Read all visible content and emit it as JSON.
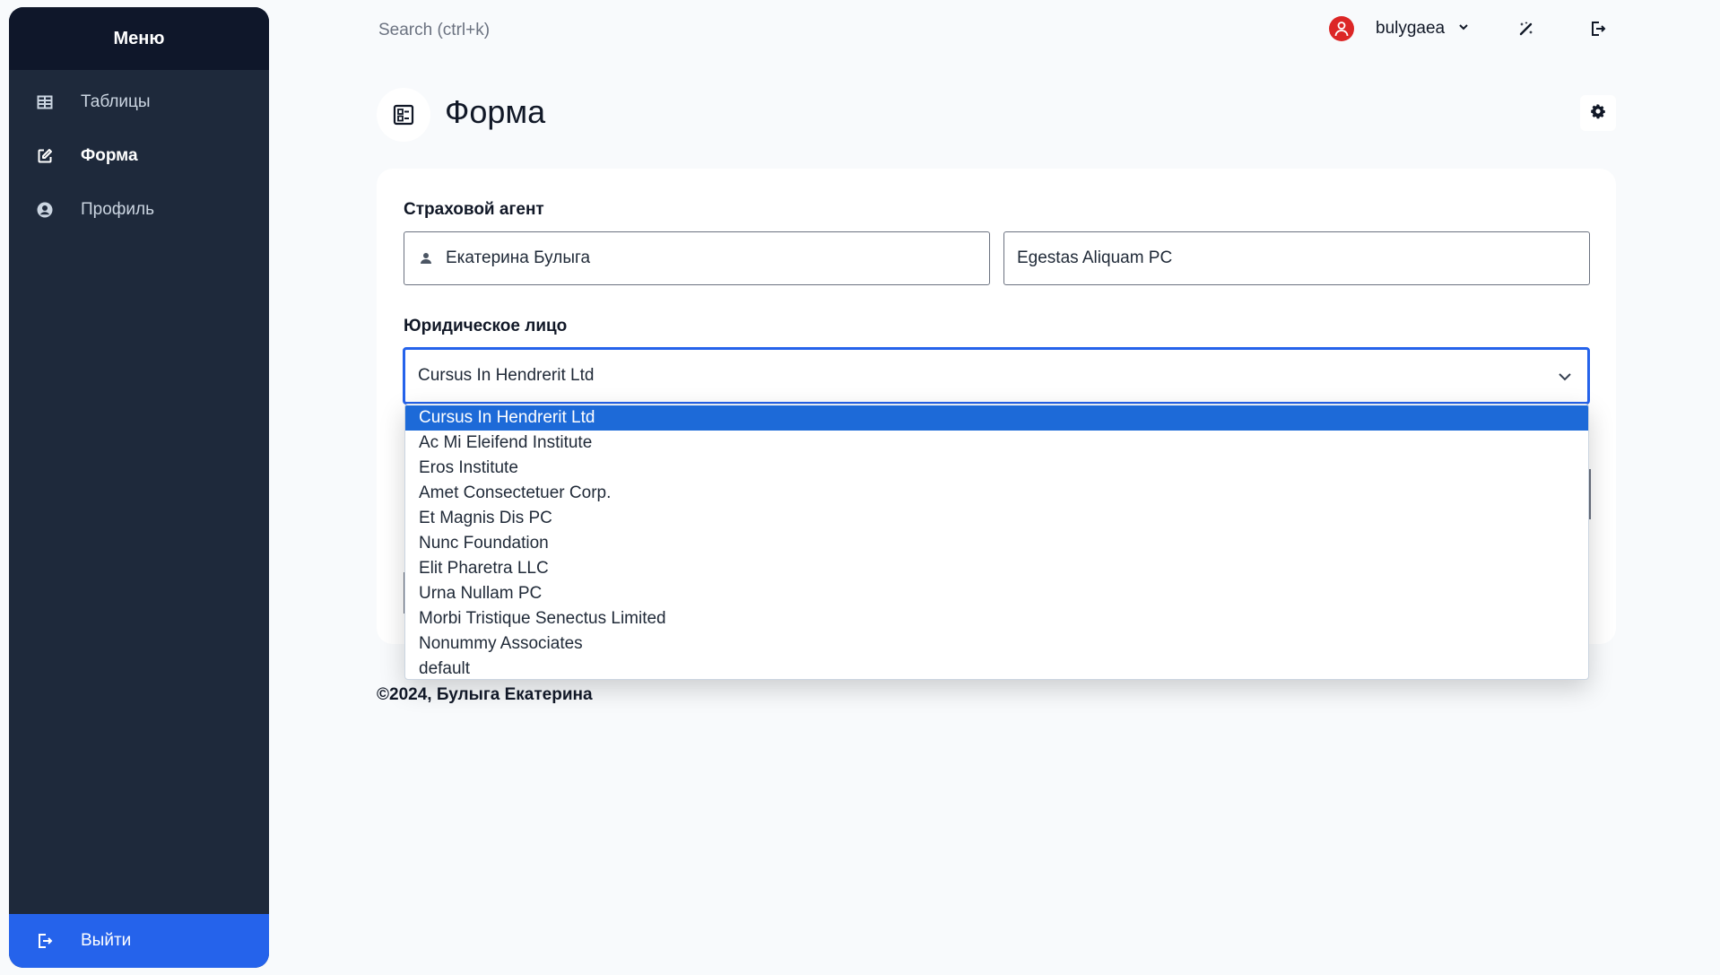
{
  "sidebar": {
    "title": "Меню",
    "items": [
      {
        "label": "Таблицы",
        "icon": "table-icon"
      },
      {
        "label": "Форма",
        "icon": "edit-icon"
      },
      {
        "label": "Профиль",
        "icon": "user-circle-icon"
      }
    ],
    "logout_label": "Выйти",
    "colors": {
      "bg": "#1e293b",
      "header": "#0f172a",
      "logout": "#2563eb"
    }
  },
  "topbar": {
    "search_placeholder": "Search (ctrl+k)",
    "username": "bulygaea"
  },
  "page": {
    "title": "Форма"
  },
  "form": {
    "agent_label": "Страховой агент",
    "agent_name": "Екатерина Булыга",
    "agent_company": "Egestas Aliquam PC",
    "legal_entity_label": "Юридическое лицо",
    "legal_entity_value": "Cursus In Hendrerit Ltd",
    "legal_entity_options": [
      "Cursus In Hendrerit Ltd",
      "Ac Mi Eleifend Institute",
      "Eros Institute",
      "Amet Consectetuer Corp.",
      "Et Magnis Dis PC",
      "Nunc Foundation",
      "Elit Pharetra LLC",
      "Urna Nullam PC",
      "Morbi Tristique Senectus Limited",
      "Nonummy Associates",
      "default"
    ]
  },
  "footer": {
    "text": "©2024, Булыга Екатерина"
  },
  "colors": {
    "accent": "#2563eb",
    "selected_option": "#1d6ad8",
    "avatar": "#dc2626"
  }
}
